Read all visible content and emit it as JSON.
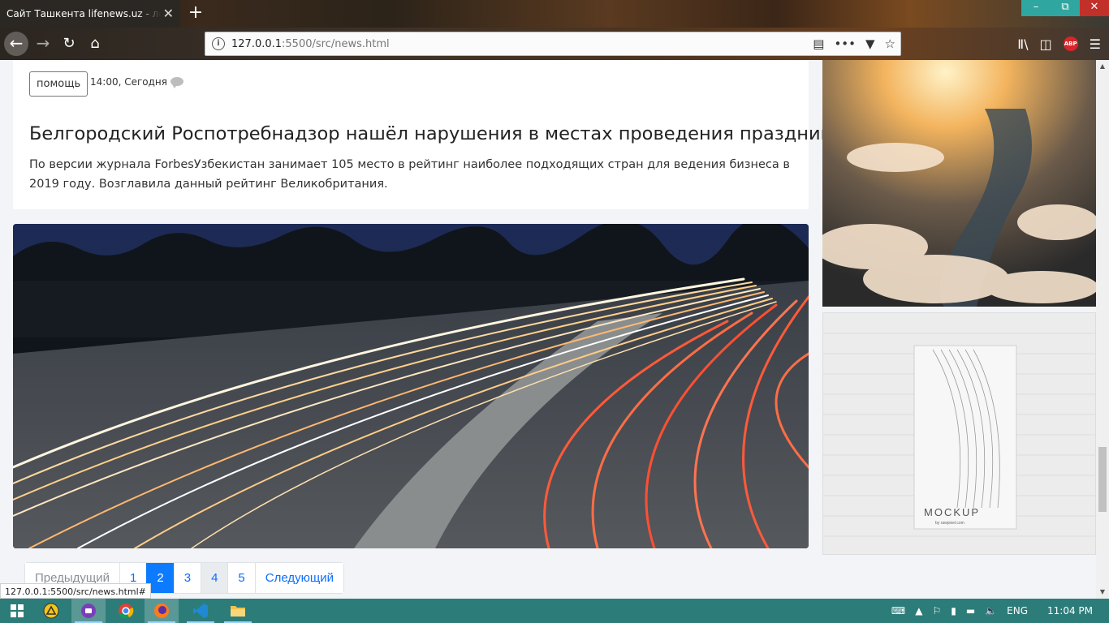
{
  "browser": {
    "tab_title": "Сайт Ташкента lifenews.uz - лента",
    "tab_close": "✕",
    "new_tab": "+",
    "url_host": "127.0.0.1",
    "url_rest": ":5500/src/news.html",
    "status_link": "127.0.0.1:5500/src/news.html#"
  },
  "article": {
    "tag": "помощь",
    "meta": "14:00, Сегодня",
    "title": "Белгородский Роспотребнадзор нашёл нарушения в местах проведения праздников",
    "text": "По версии журнала ForbesУзбекистан занимает 105 место в рейтинг наиболее подходящих стран для ведения бизнеса в 2019 году. Возглавила данный рейтинг Великобритания."
  },
  "side": {
    "mockup_label": "MOCKUP",
    "mockup_sub": "by rawpixel.com"
  },
  "pagination": {
    "prev": "Предыдущий",
    "pages": [
      "1",
      "2",
      "3",
      "4",
      "5"
    ],
    "next": "Следующий",
    "active_page": "2"
  },
  "taskbar": {
    "lang": "ENG",
    "time": "11:04 PM"
  },
  "icons": [
    "back-icon",
    "forward-icon",
    "reload-icon",
    "home-icon",
    "info-icon",
    "reader-icon",
    "more-icon",
    "pocket-icon",
    "star-icon",
    "library-icon",
    "sidebar-icon",
    "adblock-icon",
    "menu-icon",
    "comment-icon",
    "windows-icon"
  ]
}
